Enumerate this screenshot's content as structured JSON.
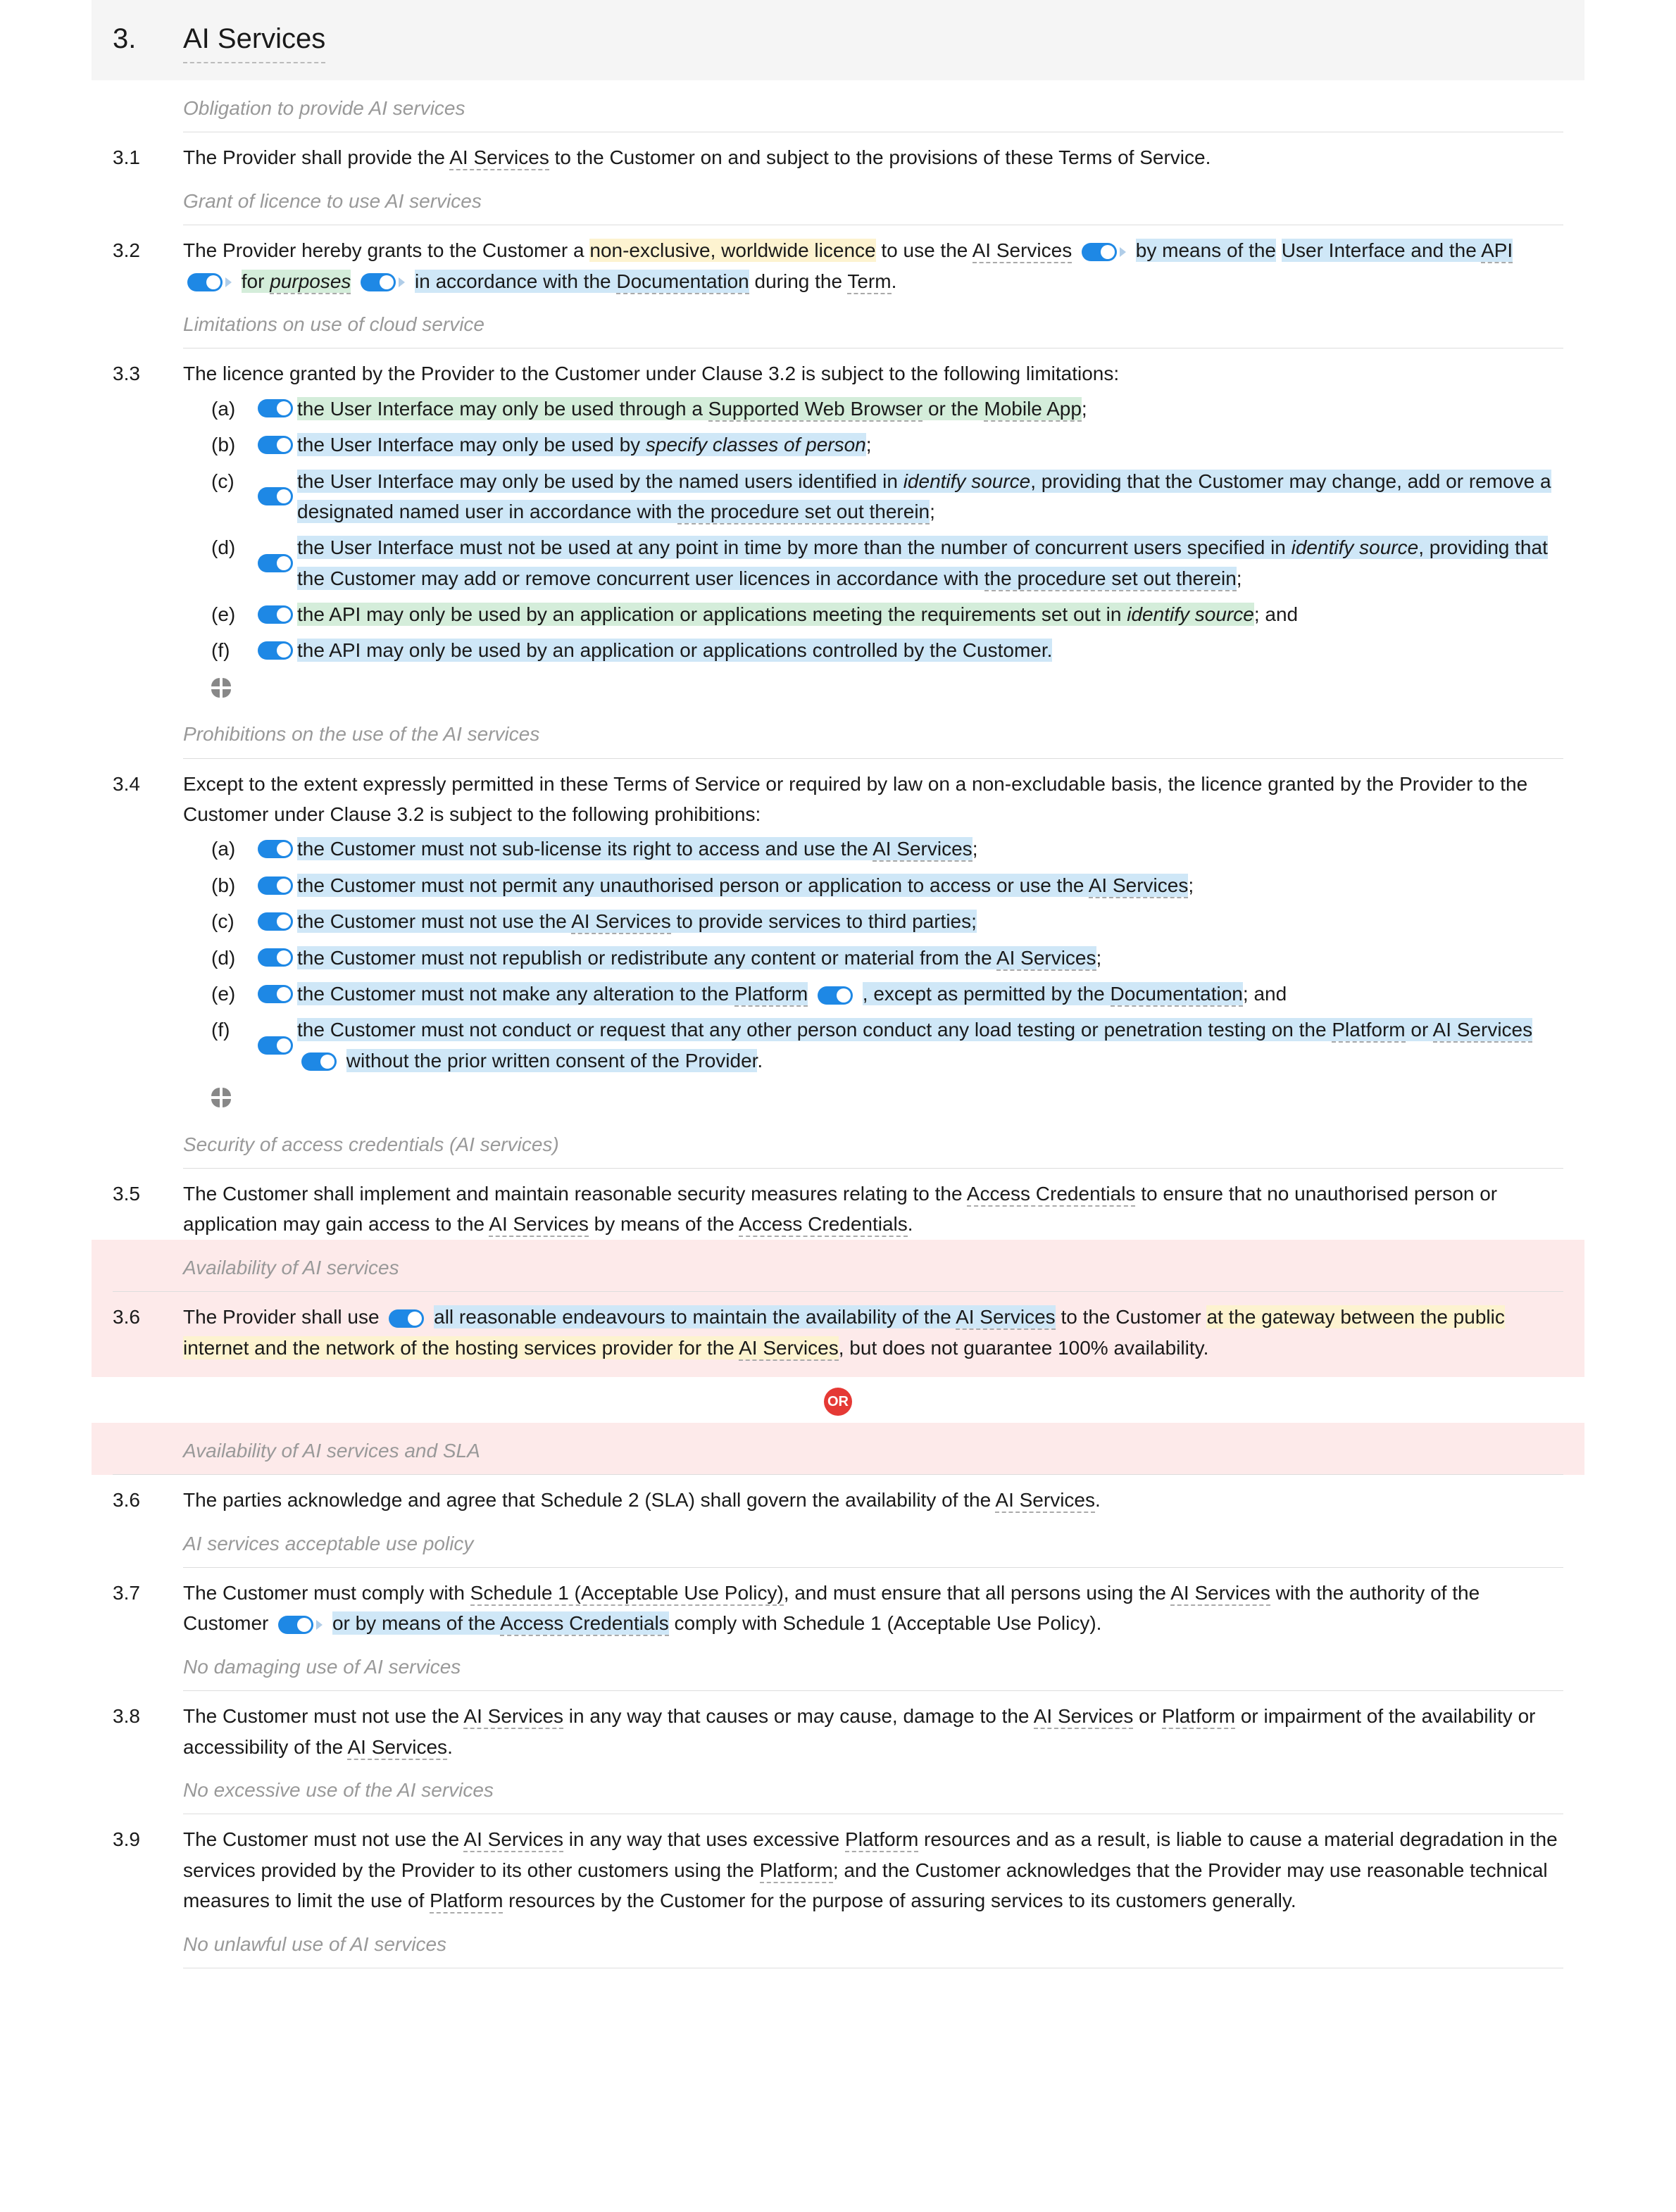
{
  "section": {
    "num": "3.",
    "title": "AI Services"
  },
  "sh": {
    "s31": "Obligation to provide AI services",
    "s32": "Grant of licence to use AI services",
    "s33": "Limitations on use of cloud service",
    "s34": "Prohibitions on the use of the AI services",
    "s35": "Security of access credentials (AI services)",
    "s36a": "Availability of AI services",
    "s36b": "Availability of AI services and SLA",
    "s37": "AI services acceptable use policy",
    "s38": "No damaging use of AI services",
    "s39": "No excessive use of the AI services",
    "s310": "No unlawful use of AI services"
  },
  "c31": {
    "num": "3.1",
    "t1": "The Provider shall provide the ",
    "ai": "AI Services",
    "t2": " to the Customer on and subject to the provisions of these Terms of Service."
  },
  "c32": {
    "num": "3.2",
    "t1": "The Provider hereby grants to the Customer a ",
    "lic": "non-exclusive, worldwide licence",
    "t2": " to use the ",
    "ai": "AI Services",
    "by1": "by means of the",
    "by2": "User Interface and the ",
    "api": "API",
    "for": "for ",
    "purposes": "purposes",
    "acc": "in accordance with the ",
    "doc": "Documentation",
    "during": " during the ",
    "term": "Term",
    "dot": "."
  },
  "c33": {
    "num": "3.3",
    "intro": "The licence granted by the Provider to the Customer under Clause 3.2 is subject to the following limitations:",
    "items": [
      {
        "lbl": "(a)",
        "t1": "the User Interface may only be used through a ",
        "dot1": "Supported Web Browser",
        "t2": " or the ",
        "dot2": "Mobile App",
        "tail": ";"
      },
      {
        "lbl": "(b)",
        "t1": "the User Interface may only be used by ",
        "ph": "specify classes of person",
        "tail": ";"
      },
      {
        "lbl": "(c)",
        "t1": "the User Interface may only be used by the named users identified in ",
        "ph": "identify source",
        "t2": ", providing that the Customer may change, add or remove a designated named user in accordance with ",
        "dot1": "the procedure set out therein",
        "tail": ";"
      },
      {
        "lbl": "(d)",
        "t1": "the User Interface must not be used at any point in time by more than the number of concurrent users specified in ",
        "ph": "identify source",
        "t2": ", providing that the Customer may add or remove concurrent user licences in accordance with ",
        "dot1": "the procedure set out therein",
        "tail": ";"
      },
      {
        "lbl": "(e)",
        "t1": "the API may only be used by an application or applications meeting the requirements set out in ",
        "ph": "identify source",
        "tail": "; and"
      },
      {
        "lbl": "(f)",
        "t1": "the API may only be used by an application or applications controlled by the Customer.",
        "tail": ""
      }
    ]
  },
  "c34": {
    "num": "3.4",
    "intro": "Except to the extent expressly permitted in these Terms of Service or required by law on a non-excludable basis, the licence granted by the Provider to the Customer under Clause 3.2 is subject to the following prohibitions:",
    "items": [
      {
        "lbl": "(a)",
        "t1": "the Customer must not sub-license its right to access and use the ",
        "ai": "AI Services",
        "tail": ";"
      },
      {
        "lbl": "(b)",
        "t1": "the Customer must not permit any unauthorised person or application to access or use the ",
        "ai": "AI Services",
        "tail": ";"
      },
      {
        "lbl": "(c)",
        "t1": "the Customer must not use the ",
        "ai": "AI Services",
        "t2": " to provide services to third parties;",
        "tail": ""
      },
      {
        "lbl": "(d)",
        "t1": "the Customer must not republish or redistribute any content or material from the ",
        "ai": "AI Services",
        "tail": ";"
      },
      {
        "lbl": "(e)",
        "t1": "the Customer must not make any alteration to the ",
        "ai": "Platform",
        "except": ", except as permitted by the ",
        "doc": "Documentation",
        "tail": "; and"
      },
      {
        "lbl": "(f)",
        "t1": "the Customer must not conduct or request that any other person conduct any load testing or penetration testing on the ",
        "ai": "Platform",
        "t2": " or ",
        "ai2": "AI Services",
        "consent": "without the prior written consent of the Provider",
        "tail": "."
      }
    ]
  },
  "c35": {
    "num": "3.5",
    "t1": "The Customer shall implement and maintain reasonable security measures relating to the ",
    "ac1": "Access Credentials",
    "t2": " to ensure that no unauthorised person or application may gain access to the ",
    "ai": "AI Services",
    "t3": " by means of the ",
    "ac2": "Access Credentials",
    "dot": "."
  },
  "c36a": {
    "num": "3.6",
    "t1": "The Provider shall use ",
    "eff": "all reasonable endeavours to maintain the availability of the ",
    "ai": "AI Services",
    "t2": " to the Customer ",
    "gw1": "at the gateway between the public internet and the network of the hosting services provider for the ",
    "ai2": "AI Services",
    "t3": ", but does not guarantee 100% availability."
  },
  "or": "OR",
  "c36b": {
    "num": "3.6",
    "t1": "The parties acknowledge and agree that Schedule 2 (SLA) shall govern the availability of the ",
    "ai": "AI Services",
    "dot": "."
  },
  "c37": {
    "num": "3.7",
    "t1": "The Customer must comply with ",
    "sched": "Schedule 1 (Acceptable Use Policy)",
    "t2": ", and must ensure that all persons using the ",
    "ai": "AI Services",
    "t3": " with the authority of the Customer ",
    "or1": "or by means of the ",
    "ac": "Access Credentials",
    "t4": " comply with Schedule 1 (Acceptable Use Policy)."
  },
  "c38": {
    "num": "3.8",
    "t1": "The Customer must not use the ",
    "ai1": "AI Services",
    "t2": " in any way that causes or may cause, damage to the ",
    "ai2": "AI Services",
    "t3": " or ",
    "pf": "Platform",
    "t4": " or impairment of the availability or accessibility of the ",
    "ai3": "AI Services",
    "dot": "."
  },
  "c39": {
    "num": "3.9",
    "t1": "The Customer must not use the ",
    "ai": "AI Services",
    "t2": " in any way that uses excessive ",
    "pf1": "Platform",
    "t3": " resources and as a result, is liable to cause a material degradation in the services provided by the Provider to its other customers using the ",
    "pf2": "Platform",
    "t4": "; and the Customer acknowledges that the Provider may use reasonable technical measures to limit the use of ",
    "pf3": "Platform",
    "t5": " resources by the Customer for the purpose of assuring services to its customers generally."
  }
}
